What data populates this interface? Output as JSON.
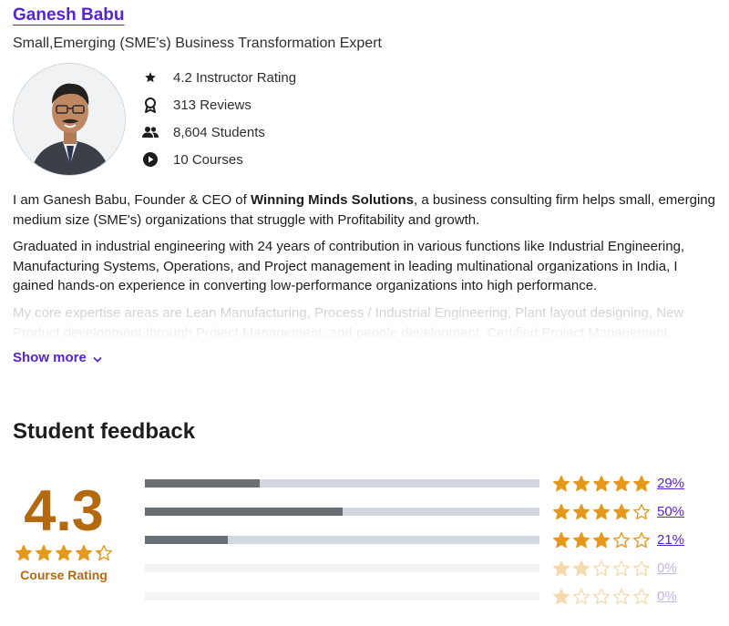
{
  "instructor": {
    "name": "Ganesh Babu",
    "headline": "Small,Emerging (SME's) Business Transformation Expert",
    "stats": [
      {
        "icon": "star-icon",
        "label": "4.2 Instructor Rating"
      },
      {
        "icon": "award-icon",
        "label": "313 Reviews"
      },
      {
        "icon": "users-icon",
        "label": "8,604 Students"
      },
      {
        "icon": "play-icon",
        "label": "10 Courses"
      }
    ],
    "bio": {
      "p1_before": "I am Ganesh Babu, Founder & CEO of ",
      "p1_strong": "Winning Minds Solutions",
      "p1_after": ", a business consulting firm helps small, emerging medium size (SME's) organizations that struggle with Profitability and growth.",
      "p2": "Graduated in industrial engineering with 24 years of contribution in various functions like Industrial Engineering, Manufacturing Systems, Operations, and Project management in leading multinational organizations in India, I gained hands-on experience in converting low-performance organizations into high performance.",
      "p3": "My core expertise areas are Lean Manufacturing, Process / Industrial Engineering, Plant layout designing, New Product development through Project Management, and people development, Certified Project Management"
    },
    "show_more": "Show more"
  },
  "feedback": {
    "title": "Student feedback",
    "rating": "4.3",
    "rating_value": 4.3,
    "rating_label": "Course Rating",
    "colors": {
      "star": "#e59819",
      "bar_fill": "#6a6f73",
      "bar_track": "#d1d7dc",
      "accent": "#5624d0",
      "rating": "#b4690e"
    },
    "distribution": [
      {
        "stars": 5,
        "percent": "29%",
        "fraction": 0.29
      },
      {
        "stars": 4,
        "percent": "50%",
        "fraction": 0.5
      },
      {
        "stars": 3,
        "percent": "21%",
        "fraction": 0.21
      },
      {
        "stars": 2,
        "percent": "0%",
        "fraction": 0.0
      },
      {
        "stars": 1,
        "percent": "0%",
        "fraction": 0.0
      }
    ]
  }
}
